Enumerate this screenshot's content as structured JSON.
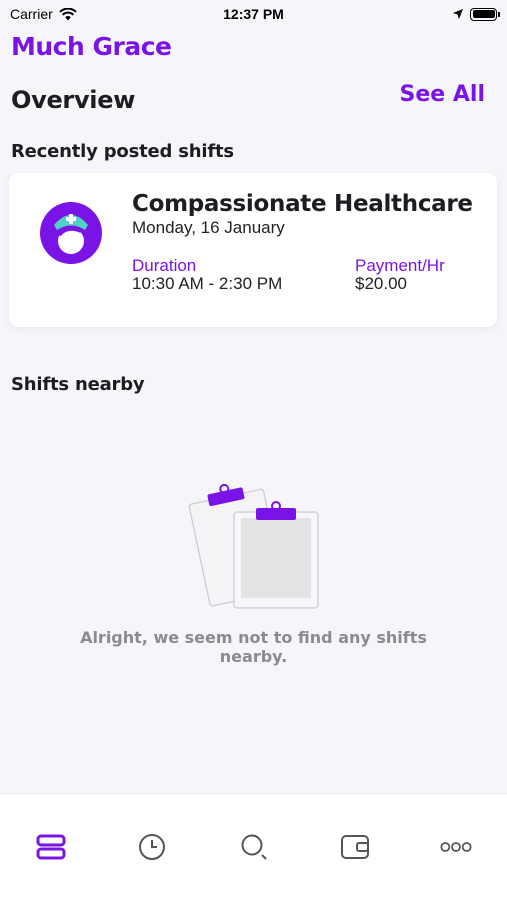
{
  "status_bar": {
    "carrier": "Carrier",
    "time": "12:37 PM"
  },
  "app": {
    "logo_text": "Much Grace",
    "brand_color": "#7a14e6"
  },
  "overview": {
    "title": "Overview",
    "see_all": "See All"
  },
  "recent": {
    "title": "Recently posted shifts",
    "shift": {
      "company": "Compassionate Healthcare",
      "date": "Monday, 16 January",
      "duration_label": "Duration",
      "duration_value": "10:30 AM - 2:30 PM",
      "payment_label": "Payment/Hr",
      "payment_value": "$20.00"
    }
  },
  "nearby": {
    "title": "Shifts nearby",
    "empty_message": "Alright, we seem not to find any shifts nearby."
  },
  "tabbar": {
    "items": [
      {
        "icon": "stack-icon",
        "active": true
      },
      {
        "icon": "clock-icon",
        "active": false
      },
      {
        "icon": "search-icon",
        "active": false
      },
      {
        "icon": "wallet-icon",
        "active": false
      },
      {
        "icon": "more-icon",
        "active": false
      }
    ]
  }
}
